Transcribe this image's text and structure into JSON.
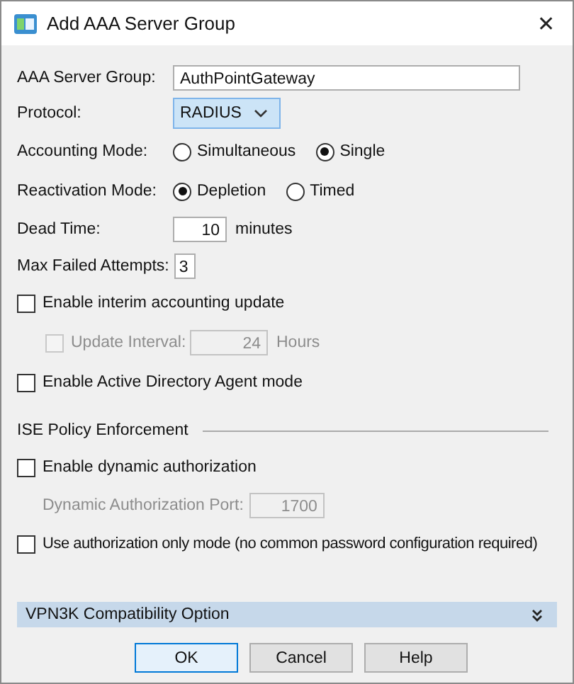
{
  "window": {
    "title": "Add AAA Server Group",
    "close": "✕"
  },
  "server_group": {
    "label": "AAA Server Group:",
    "value": "AuthPointGateway"
  },
  "protocol": {
    "label": "Protocol:",
    "value": "RADIUS"
  },
  "accounting_mode": {
    "label": "Accounting Mode:",
    "options": [
      {
        "label": "Simultaneous",
        "selected": false
      },
      {
        "label": "Single",
        "selected": true
      }
    ]
  },
  "reactivation_mode": {
    "label": "Reactivation Mode:",
    "options": [
      {
        "label": "Depletion",
        "selected": true
      },
      {
        "label": "Timed",
        "selected": false
      }
    ]
  },
  "dead_time": {
    "label": "Dead Time:",
    "value": "10",
    "unit": "minutes"
  },
  "max_failed_attempts": {
    "label": "Max Failed Attempts:",
    "value": "3"
  },
  "interim_update": {
    "label": "Enable interim accounting update",
    "checked": false
  },
  "update_interval": {
    "label": "Update Interval:",
    "value": "24",
    "unit": "Hours",
    "checked": false,
    "disabled": true
  },
  "ad_agent": {
    "label": "Enable Active Directory Agent mode",
    "checked": false
  },
  "ise_section": {
    "title": "ISE Policy Enforcement"
  },
  "dynamic_auth": {
    "label": "Enable dynamic authorization",
    "checked": false
  },
  "dynamic_auth_port": {
    "label": "Dynamic Authorization Port:",
    "value": "1700",
    "disabled": true
  },
  "auth_only": {
    "label": "Use authorization only mode (no common password configuration required)",
    "checked": false
  },
  "vpn3k": {
    "label": "VPN3K Compatibility Option",
    "expanded": false
  },
  "buttons": [
    {
      "label": "OK",
      "default": true
    },
    {
      "label": "Cancel",
      "default": false
    },
    {
      "label": "Help",
      "default": false
    }
  ]
}
